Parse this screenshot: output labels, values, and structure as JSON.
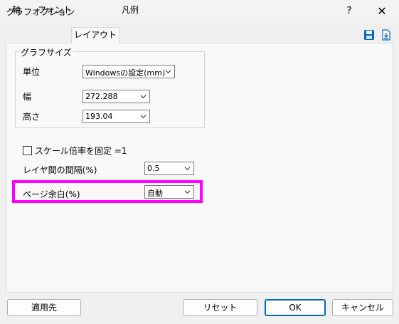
{
  "window": {
    "title": "グラフオプション",
    "help_label": "?",
    "close_label": "✕"
  },
  "tabs": [
    {
      "label": "軸",
      "active": false
    },
    {
      "label": "フォント",
      "active": false
    },
    {
      "label": "レイアウト",
      "active": true
    },
    {
      "label": "凡例",
      "active": false
    }
  ],
  "toolbar": {
    "save_icon": "save-icon",
    "import_icon": "import-icon",
    "accent": "#0067c0"
  },
  "graph_size": {
    "legend": "グラフサイズ",
    "unit_label": "単位",
    "unit_value": "Windowsの設定(mm)",
    "width_label": "幅",
    "width_value": "272.288",
    "height_label": "高さ",
    "height_value": "193.04"
  },
  "scale_fixed": {
    "label": "スケール倍率を固定 =1",
    "checked": false
  },
  "layer_spacing": {
    "label": "レイヤ間の間隔(%)",
    "value": "0.5"
  },
  "page_margin": {
    "label": "ページ余白(%)",
    "value": "自動",
    "highlight_color": "#ff00ff"
  },
  "buttons": {
    "apply_to": "適用先",
    "reset": "リセット",
    "ok": "OK",
    "cancel": "キャンセル"
  }
}
